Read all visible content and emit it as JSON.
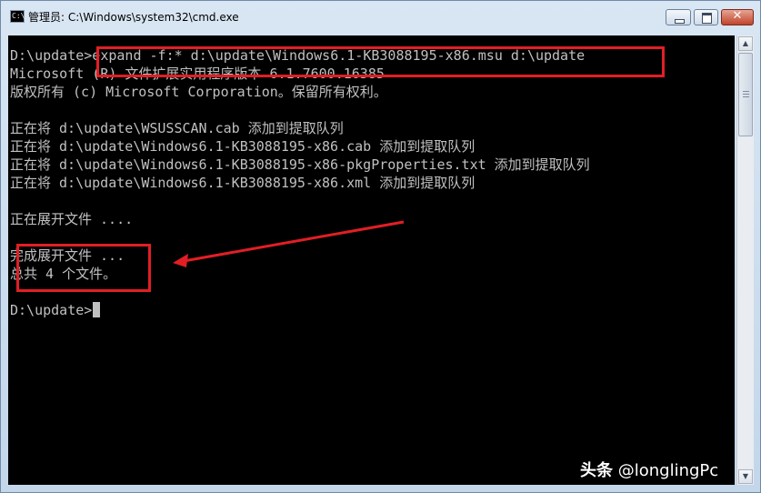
{
  "window": {
    "title": "管理员: C:\\Windows\\system32\\cmd.exe",
    "icon": "cmd-icon",
    "controls": {
      "minimize_icon": "minimize-icon",
      "maximize_icon": "maximize-icon",
      "close_icon": "close-icon",
      "close_glyph": "✕"
    }
  },
  "console": {
    "lines": [
      "D:\\update>expand -f:* d:\\update\\Windows6.1-KB3088195-x86.msu d:\\update",
      "Microsoft (R) 文件扩展实用程序版本 6.1.7600.16385",
      "版权所有 (c) Microsoft Corporation。保留所有权利。",
      "",
      "正在将 d:\\update\\WSUSSCAN.cab 添加到提取队列",
      "正在将 d:\\update\\Windows6.1-KB3088195-x86.cab 添加到提取队列",
      "正在将 d:\\update\\Windows6.1-KB3088195-x86-pkgProperties.txt 添加到提取队列",
      "正在将 d:\\update\\Windows6.1-KB3088195-x86.xml 添加到提取队列",
      "",
      "正在展开文件 ....",
      "",
      "完成展开文件 ...",
      "总共 4 个文件。",
      "",
      "D:\\update>"
    ]
  },
  "annotations": {
    "color": "#e21e25"
  },
  "watermark": {
    "brand": "头条",
    "handle": "@longlingPc"
  }
}
